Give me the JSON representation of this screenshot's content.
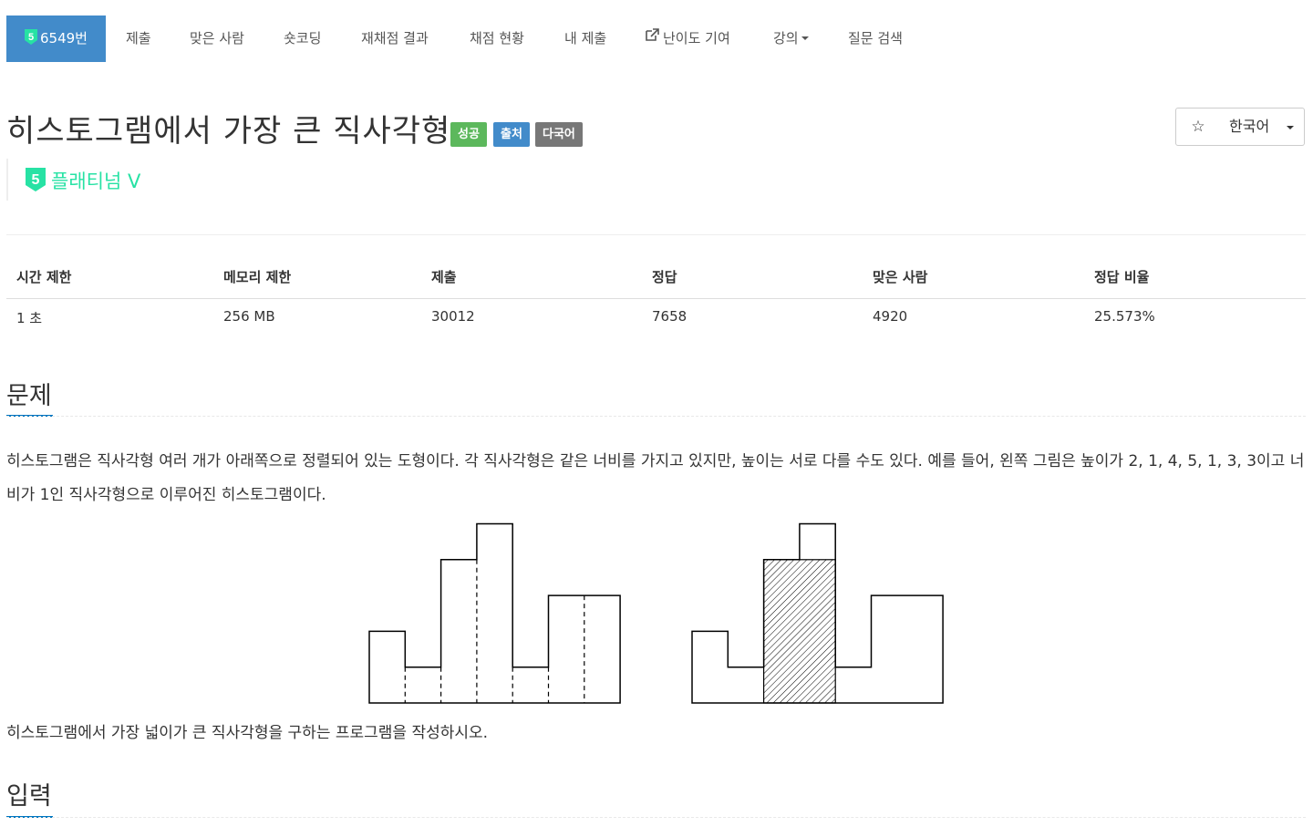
{
  "nav": {
    "problem_id": "6549번",
    "tier_digit": "5",
    "items": [
      {
        "label": "제출"
      },
      {
        "label": "맞은 사람"
      },
      {
        "label": "숏코딩"
      },
      {
        "label": "재채점 결과"
      },
      {
        "label": "채점 현황"
      },
      {
        "label": "내 제출"
      },
      {
        "label": "난이도 기여"
      },
      {
        "label": "강의"
      },
      {
        "label": "질문 검색"
      }
    ]
  },
  "title": "히스토그램에서 가장 큰 직사각형",
  "labels": {
    "success": "성공",
    "source": "출처",
    "multilang": "다국어"
  },
  "actions": {
    "star_symbol": "☆",
    "language": "한국어"
  },
  "tier": {
    "digit": "5",
    "text": "플래티넘 V",
    "color": "#27e2a4"
  },
  "info_table": {
    "headers": [
      "시간 제한",
      "메모리 제한",
      "제출",
      "정답",
      "맞은 사람",
      "정답 비율"
    ],
    "values": [
      "1 초",
      "256 MB",
      "30012",
      "7658",
      "4920",
      "25.573%"
    ]
  },
  "sections": {
    "problem": {
      "heading": "문제",
      "paragraph1": "히스토그램은 직사각형 여러 개가 아래쪽으로 정렬되어 있는 도형이다. 각 직사각형은 같은 너비를 가지고 있지만, 높이는 서로 다를 수도 있다. 예를 들어, 왼쪽 그림은 높이가 2, 1, 4, 5, 1, 3, 3이고 너비가 1인 직사각형으로 이루어진 히스토그램이다.",
      "paragraph2": "히스토그램에서 가장 넓이가 큰 직사각형을 구하는 프로그램을 작성하시오."
    },
    "input": {
      "heading": "입력"
    }
  },
  "figure": {
    "heights": [
      2,
      1,
      4,
      5,
      1,
      3,
      3
    ],
    "largest_rect": {
      "start": 2,
      "end": 3,
      "height": 4
    }
  },
  "colors": {
    "nav_active": "#428bca",
    "label_success": "#5cb85c",
    "label_source": "#428bca",
    "label_multi": "#777777",
    "section_underline": "#0076c0"
  }
}
